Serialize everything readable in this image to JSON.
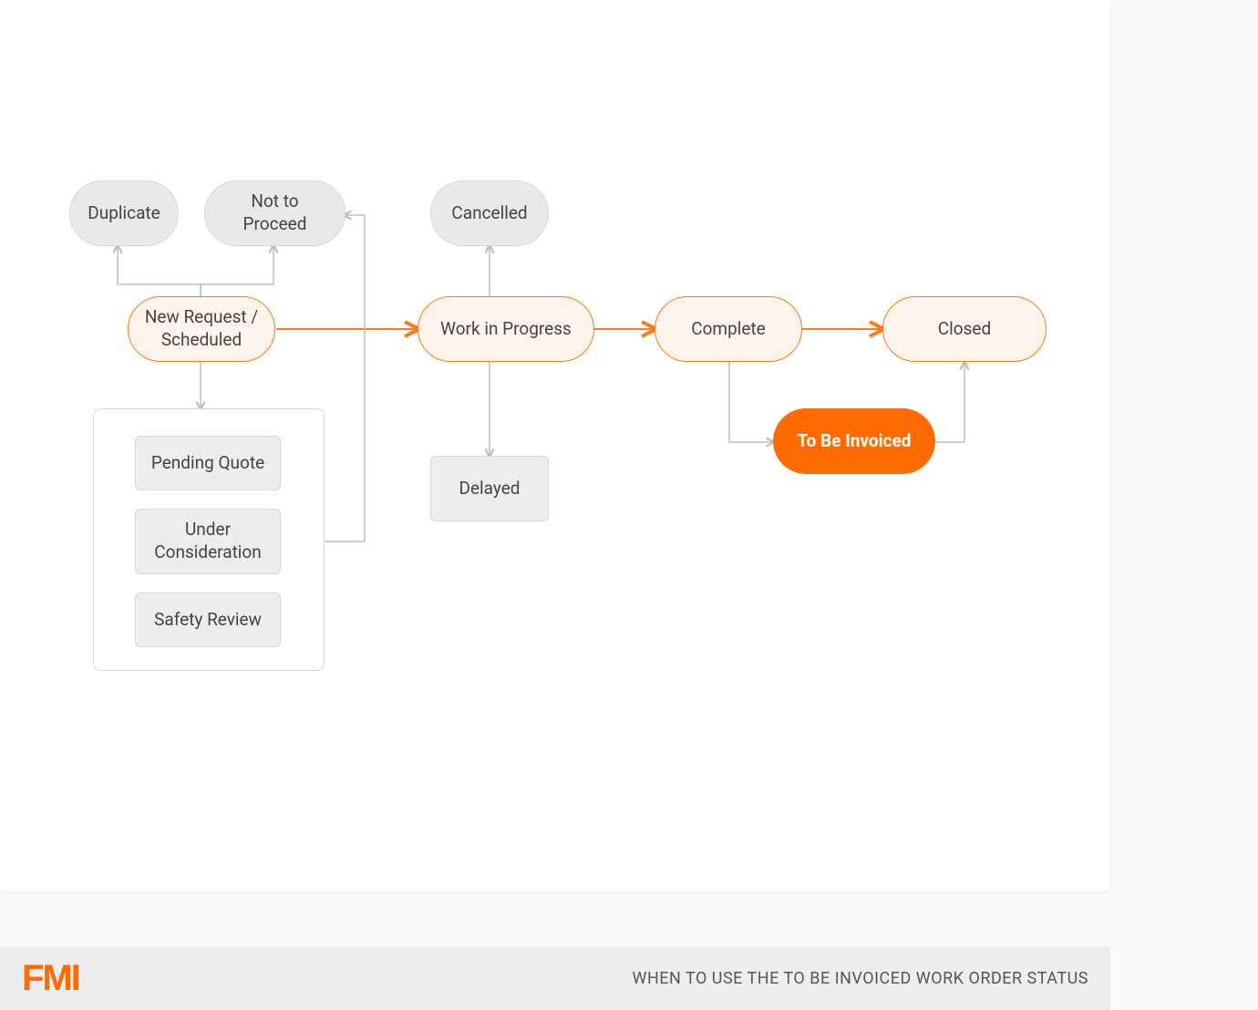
{
  "colors": {
    "accent": "#ff6b00",
    "grey_fill": "#e9e9e9",
    "grey_border": "#d7d7d7"
  },
  "nodes": {
    "duplicate": "Duplicate",
    "not_to_proceed": "Not to Proceed",
    "cancelled": "Cancelled",
    "new_request": "New Request / Scheduled",
    "work_in_progress": "Work in Progress",
    "complete": "Complete",
    "closed": "Closed",
    "to_be_invoiced": "To Be Invoiced",
    "delayed": "Delayed",
    "pending_quote": "Pending Quote",
    "under_consideration": "Under Consideration",
    "safety_review": "Safety Review"
  },
  "footer": {
    "logo": "FMI",
    "caption": "WHEN TO USE THE TO BE INVOICED WORK ORDER STATUS"
  },
  "flow": {
    "main_path": [
      "new_request",
      "work_in_progress",
      "complete",
      "closed"
    ],
    "branches": [
      {
        "from": "new_request",
        "to": "duplicate"
      },
      {
        "from": "new_request",
        "to": "not_to_proceed"
      },
      {
        "from": "new_request",
        "to": "pending_quote",
        "bidir": true
      },
      {
        "from": "new_request",
        "to": "under_consideration",
        "bidir": true
      },
      {
        "from": "new_request",
        "to": "safety_review",
        "bidir": true
      },
      {
        "from": "work_in_progress",
        "to": "cancelled"
      },
      {
        "from": "work_in_progress",
        "to": "delayed",
        "bidir": true
      },
      {
        "from": "complete",
        "to": "to_be_invoiced"
      },
      {
        "from": "to_be_invoiced",
        "to": "closed"
      },
      {
        "from": "sub_group",
        "to": "not_to_proceed"
      }
    ]
  }
}
